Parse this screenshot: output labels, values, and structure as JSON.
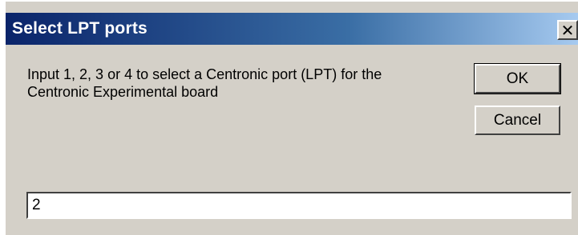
{
  "dialog": {
    "title": "Select LPT ports",
    "close_glyph": "✕",
    "close_icon": "close-icon",
    "message_line1": "Input 1, 2, 3 or 4 to select a Centronic port (LPT) for the",
    "message_line2": "Centronic Experimental board",
    "ok_label": "OK",
    "cancel_label": "Cancel",
    "input_value": "2"
  },
  "colors": {
    "titlebar_start": "#0a246a",
    "titlebar_end": "#a6caf0",
    "window_bg": "#d4d0c8"
  }
}
